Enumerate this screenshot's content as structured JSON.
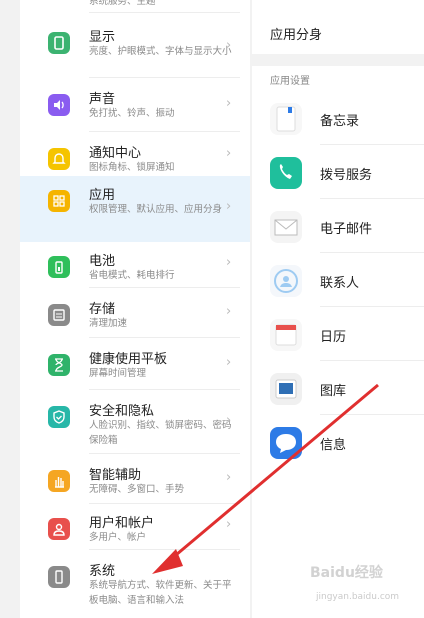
{
  "left_menu": {
    "top_fragment": "系统服务、主题",
    "items": [
      {
        "title": "显示",
        "sub": "亮度、护眼模式、字体与显示大小",
        "color": "#3cb371",
        "icon": "display-icon"
      },
      {
        "title": "声音",
        "sub": "免打扰、铃声、振动",
        "color": "#8a5cf0",
        "icon": "sound-icon"
      },
      {
        "title": "通知中心",
        "sub": "图标角标、锁屏通知",
        "color": "#f5c400",
        "icon": "bell-icon"
      },
      {
        "title": "应用",
        "sub": "权限管理、默认应用、应用分身",
        "color": "#f5b400",
        "icon": "apps-icon"
      },
      {
        "title": "电池",
        "sub": "省电模式、耗电排行",
        "color": "#2fbf5b",
        "icon": "battery-icon"
      },
      {
        "title": "存储",
        "sub": "清理加速",
        "color": "#8a8a8a",
        "icon": "storage-icon"
      },
      {
        "title": "健康使用平板",
        "sub": "屏幕时间管理",
        "color": "#2fb36a",
        "icon": "hourglass-icon"
      },
      {
        "title": "安全和隐私",
        "sub": "人脸识别、指纹、锁屏密码、密码保险箱",
        "color": "#27b7a8",
        "icon": "shield-icon"
      },
      {
        "title": "智能辅助",
        "sub": "无障碍、多窗口、手势",
        "color": "#f5a623",
        "icon": "hand-icon"
      },
      {
        "title": "用户和帐户",
        "sub": "多用户、帐户",
        "color": "#e8504c",
        "icon": "user-icon"
      },
      {
        "title": "系统",
        "sub": "系统导航方式、软件更新、关于平板电脑、语言和输入法",
        "color": "#8a8a8a",
        "icon": "phone-icon"
      }
    ]
  },
  "right_panel": {
    "top_item": "应用分身",
    "section_header": "应用设置",
    "apps": [
      {
        "label": "备忘录",
        "icon": "notes-icon",
        "color": "#f7f7f7"
      },
      {
        "label": "拨号服务",
        "icon": "phone-call-icon",
        "color": "#1fbf9c"
      },
      {
        "label": "电子邮件",
        "icon": "mail-icon",
        "color": "#f4f4f4"
      },
      {
        "label": "联系人",
        "icon": "contacts-icon",
        "color": "#f4f7fb"
      },
      {
        "label": "日历",
        "icon": "calendar-icon",
        "color": "#f7f7f7"
      },
      {
        "label": "图库",
        "icon": "gallery-icon",
        "color": "#f0f0f0"
      },
      {
        "label": "信息",
        "icon": "message-icon",
        "color": "#2d7be6"
      }
    ]
  },
  "watermark": {
    "main": "Baidu经验",
    "sub": "jingyan.baidu.com"
  },
  "colors": {
    "selected_bg": "#e8f3fc",
    "arrow": "#e02f2f"
  }
}
